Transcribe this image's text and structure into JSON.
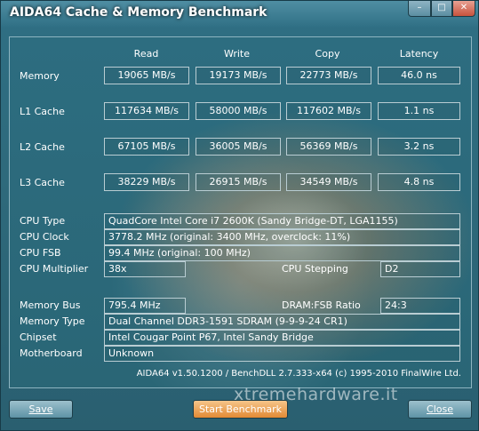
{
  "window": {
    "title": "AIDA64 Cache & Memory Benchmark",
    "controls": {
      "minimize": "–",
      "maximize": "□",
      "close": "✕"
    }
  },
  "headers": {
    "read": "Read",
    "write": "Write",
    "copy": "Copy",
    "latency": "Latency"
  },
  "rows": [
    {
      "label": "Memory",
      "read": "19065 MB/s",
      "write": "19173 MB/s",
      "copy": "22773 MB/s",
      "latency": "46.0 ns"
    },
    {
      "label": "L1 Cache",
      "read": "117634 MB/s",
      "write": "58000 MB/s",
      "copy": "117602 MB/s",
      "latency": "1.1 ns"
    },
    {
      "label": "L2 Cache",
      "read": "67105 MB/s",
      "write": "36005 MB/s",
      "copy": "56369 MB/s",
      "latency": "3.2 ns"
    },
    {
      "label": "L3 Cache",
      "read": "38229 MB/s",
      "write": "26915 MB/s",
      "copy": "34549 MB/s",
      "latency": "4.8 ns"
    }
  ],
  "cpu": {
    "type_label": "CPU Type",
    "type_value": "QuadCore Intel Core i7 2600K  (Sandy Bridge-DT, LGA1155)",
    "clock_label": "CPU Clock",
    "clock_value": "3778.2 MHz  (original: 3400 MHz, overclock: 11%)",
    "fsb_label": "CPU FSB",
    "fsb_value": "99.4 MHz  (original: 100 MHz)",
    "multiplier_label": "CPU Multiplier",
    "multiplier_value": "38x",
    "stepping_label": "CPU Stepping",
    "stepping_value": "D2"
  },
  "memory": {
    "bus_label": "Memory Bus",
    "bus_value": "795.4 MHz",
    "ratio_label": "DRAM:FSB Ratio",
    "ratio_value": "24:3",
    "type_label": "Memory Type",
    "type_value": "Dual Channel DDR3-1591 SDRAM  (9-9-9-24 CR1)",
    "chipset_label": "Chipset",
    "chipset_value": "Intel Cougar Point P67, Intel Sandy Bridge",
    "motherboard_label": "Motherboard",
    "motherboard_value": "Unknown"
  },
  "footer": "AIDA64 v1.50.1200 / BenchDLL 2.7.333-x64  (c) 1995-2010 FinalWire Ltd.",
  "buttons": {
    "save": "Save",
    "start": "Start Benchmark",
    "close": "Close"
  },
  "watermark": "xtremehardware.it"
}
